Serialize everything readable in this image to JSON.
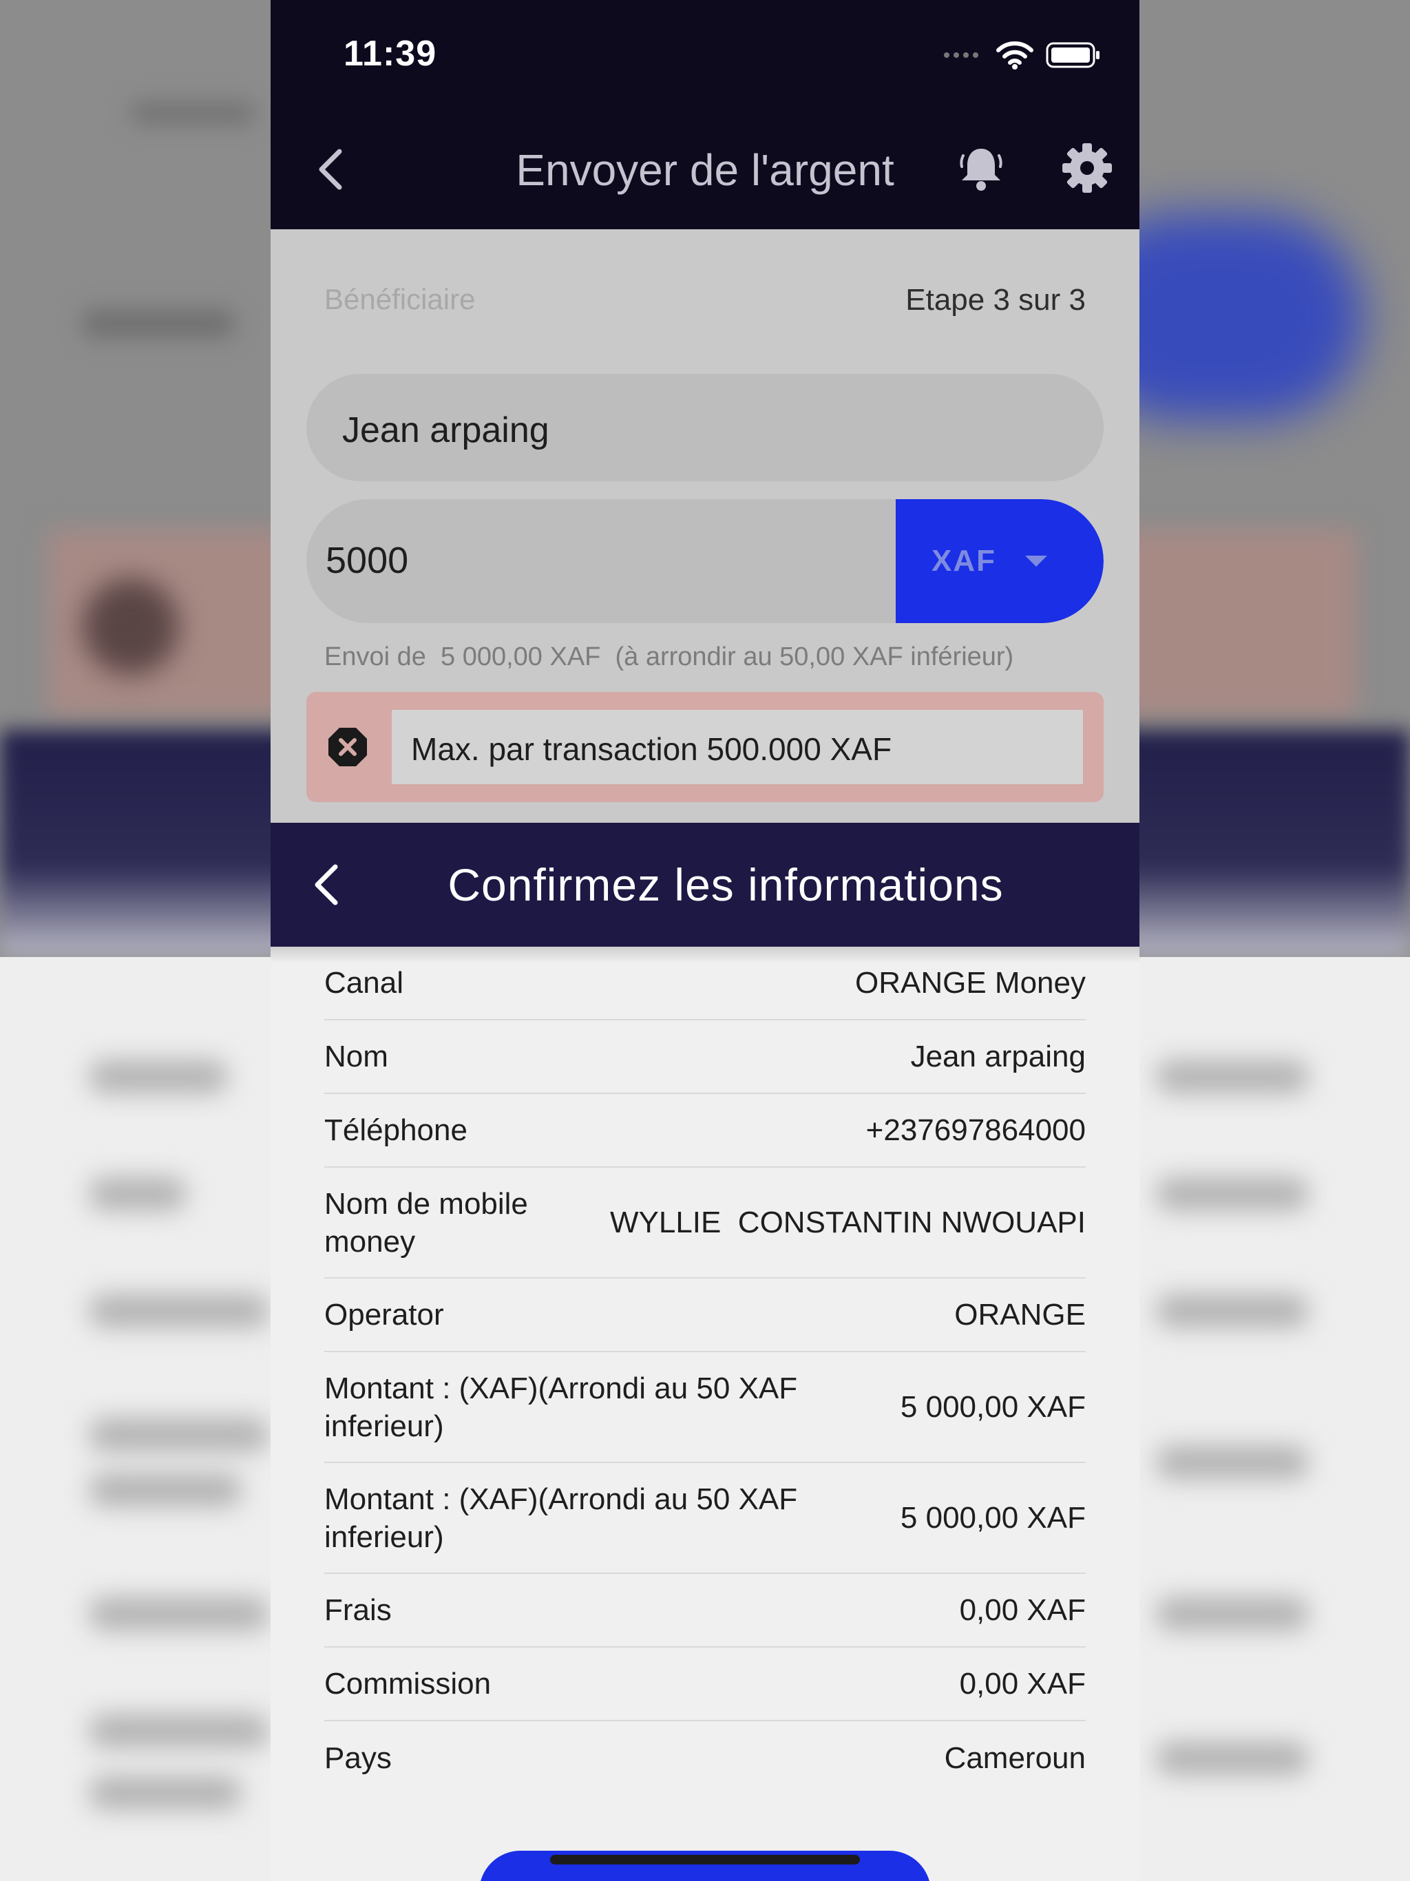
{
  "status_bar": {
    "time": "11:39"
  },
  "appbar": {
    "title": "Envoyer de l'argent"
  },
  "form": {
    "beneficiary_label": "Bénéficiaire",
    "step": "Etape 3 sur 3",
    "name_value": "Jean arpaing",
    "amount_value": "5000",
    "currency": "XAF",
    "note": "Envoi de  5 000,00 XAF  (à arrondir au 50,00 XAF inférieur)",
    "error": "Max. par transaction 500.000 XAF"
  },
  "sheet": {
    "title": "Confirmez les informations",
    "rows": [
      {
        "label": "Canal",
        "value": "ORANGE Money"
      },
      {
        "label": "Nom",
        "value": "Jean arpaing"
      },
      {
        "label": "Téléphone",
        "value": "+237697864000"
      },
      {
        "label": "Nom de mobile money",
        "value": "WYLLIE  CONSTANTIN NWOUAPI"
      },
      {
        "label": "Operator",
        "value": "ORANGE"
      },
      {
        "label": "Montant : (XAF)(Arrondi au 50 XAF inferieur)",
        "value": "5 000,00 XAF"
      },
      {
        "label": "Montant : (XAF)(Arrondi au 50 XAF inferieur)",
        "value": "5 000,00 XAF"
      },
      {
        "label": "Frais",
        "value": "0,00 XAF"
      },
      {
        "label": "Commission",
        "value": "0,00 XAF"
      },
      {
        "label": "Pays",
        "value": "Cameroun"
      }
    ]
  },
  "icons": {
    "back": "chevron-left-icon",
    "bell": "bell-icon",
    "settings": "gear-icon",
    "error": "error-octagon-icon",
    "dropdown": "caret-down-icon"
  },
  "colors": {
    "appbar": "#0e0a1e",
    "sheet_header": "#1e1844",
    "accent": "#1a2fe6",
    "error_bg": "#d4a9a6"
  }
}
